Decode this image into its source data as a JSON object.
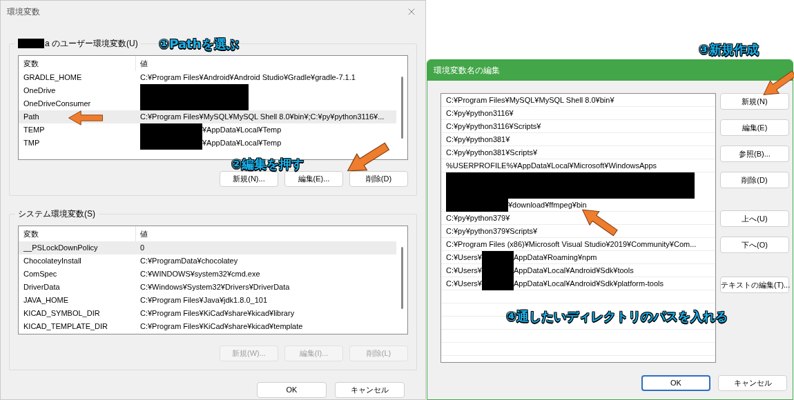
{
  "env_dialog": {
    "title": "環境変数",
    "user_group": {
      "label": [
        {
          "kind": "redacted"
        },
        {
          "kind": "text",
          "text": "a のユーザー環境変数(U)"
        }
      ],
      "columns": [
        "変数",
        "値"
      ],
      "rows": [
        {
          "name": "GRADLE_HOME",
          "value": [
            {
              "kind": "text",
              "text": "C:¥Program Files¥Android¥Android Studio¥Gradle¥gradle-7.1.1"
            }
          ],
          "selected": false
        },
        {
          "name": "OneDrive",
          "value": [
            {
              "kind": "redacted"
            }
          ],
          "selected": false
        },
        {
          "name": "OneDriveConsumer",
          "value": [
            {
              "kind": "redacted"
            }
          ],
          "selected": false
        },
        {
          "name": "Path",
          "value": [
            {
              "kind": "text",
              "text": "C:¥Program Files¥MySQL¥MySQL Shell 8.0¥bin¥;C:¥py¥python3116¥..."
            }
          ],
          "selected": true
        },
        {
          "name": "TEMP",
          "value": [
            {
              "kind": "redacted"
            },
            {
              "kind": "text",
              "text": "¥AppData¥Local¥Temp"
            }
          ],
          "selected": false
        },
        {
          "name": "TMP",
          "value": [
            {
              "kind": "redacted"
            },
            {
              "kind": "text",
              "text": "¥AppData¥Local¥Temp"
            }
          ],
          "selected": false
        }
      ],
      "buttons": [
        {
          "label": "新規(N)...",
          "disabled": false
        },
        {
          "label": "編集(E)...",
          "disabled": false
        },
        {
          "label": "削除(D)",
          "disabled": false
        }
      ]
    },
    "system_group": {
      "label": [
        {
          "kind": "text",
          "text": "システム環境変数(S)"
        }
      ],
      "columns": [
        "変数",
        "値"
      ],
      "rows": [
        {
          "name": "__PSLockDownPolicy",
          "value": [
            {
              "kind": "text",
              "text": "0"
            }
          ],
          "selected": true
        },
        {
          "name": "ChocolateyInstall",
          "value": [
            {
              "kind": "text",
              "text": "C:¥ProgramData¥chocolatey"
            }
          ],
          "selected": false
        },
        {
          "name": "ComSpec",
          "value": [
            {
              "kind": "text",
              "text": "C:¥WINDOWS¥system32¥cmd.exe"
            }
          ],
          "selected": false
        },
        {
          "name": "DriverData",
          "value": [
            {
              "kind": "text",
              "text": "C:¥Windows¥System32¥Drivers¥DriverData"
            }
          ],
          "selected": false
        },
        {
          "name": "JAVA_HOME",
          "value": [
            {
              "kind": "text",
              "text": "C:¥Program Files¥Java¥jdk1.8.0_101"
            }
          ],
          "selected": false
        },
        {
          "name": "KICAD_SYMBOL_DIR",
          "value": [
            {
              "kind": "text",
              "text": "C:¥Program Files¥KiCad¥share¥kicad¥library"
            }
          ],
          "selected": false
        },
        {
          "name": "KICAD_TEMPLATE_DIR",
          "value": [
            {
              "kind": "text",
              "text": "C:¥Program Files¥KiCad¥share¥kicad¥template"
            }
          ],
          "selected": false
        }
      ],
      "buttons": [
        {
          "label": "新規(W)...",
          "disabled": true
        },
        {
          "label": "編集(I)...",
          "disabled": true
        },
        {
          "label": "削除(L)",
          "disabled": true
        }
      ]
    },
    "buttons": [
      {
        "label": "OK",
        "default": false
      },
      {
        "label": "キャンセル",
        "default": false
      }
    ]
  },
  "edit_dialog": {
    "title": "環境変数名の編集",
    "active": true,
    "items": [
      {
        "kind": "text",
        "parts": [
          {
            "kind": "text",
            "text": "C:¥Program Files¥MySQL¥MySQL Shell 8.0¥bin¥"
          }
        ]
      },
      {
        "kind": "text",
        "parts": [
          {
            "kind": "text",
            "text": "C:¥py¥python3116¥"
          }
        ]
      },
      {
        "kind": "text",
        "parts": [
          {
            "kind": "text",
            "text": "C:¥py¥python3116¥Scripts¥"
          }
        ]
      },
      {
        "kind": "text",
        "parts": [
          {
            "kind": "text",
            "text": "C:¥py¥python381¥"
          }
        ]
      },
      {
        "kind": "text",
        "parts": [
          {
            "kind": "text",
            "text": "C:¥py¥python381¥Scripts¥"
          }
        ]
      },
      {
        "kind": "text",
        "parts": [
          {
            "kind": "text",
            "text": "%USERPROFILE%¥AppData¥Local¥Microsoft¥WindowsApps"
          }
        ]
      },
      {
        "kind": "hidden"
      },
      {
        "kind": "hidden"
      },
      {
        "kind": "text",
        "parts": [
          {
            "kind": "redacted"
          },
          {
            "kind": "text",
            "text": "¥download¥ffmpeg¥bin"
          }
        ]
      },
      {
        "kind": "text",
        "parts": [
          {
            "kind": "text",
            "text": "C:¥py¥python379¥"
          }
        ]
      },
      {
        "kind": "text",
        "parts": [
          {
            "kind": "text",
            "text": "C:¥py¥python379¥Scripts¥"
          }
        ]
      },
      {
        "kind": "text",
        "parts": [
          {
            "kind": "text",
            "text": "C:¥Program Files (x86)¥Microsoft Visual Studio¥2019¥Community¥Com..."
          }
        ]
      },
      {
        "kind": "text",
        "parts": [
          {
            "kind": "text",
            "text": "C:¥Users¥"
          },
          {
            "kind": "redacted"
          },
          {
            "kind": "text",
            "text": "AppData¥Roaming¥npm"
          }
        ]
      },
      {
        "kind": "text",
        "parts": [
          {
            "kind": "text",
            "text": "C:¥Users¥"
          },
          {
            "kind": "redacted"
          },
          {
            "kind": "text",
            "text": "AppData¥Local¥Android¥Sdk¥tools"
          }
        ]
      },
      {
        "kind": "text",
        "parts": [
          {
            "kind": "text",
            "text": "C:¥Users¥"
          },
          {
            "kind": "redacted"
          },
          {
            "kind": "text",
            "text": "AppData¥Local¥Android¥Sdk¥platform-tools"
          }
        ]
      }
    ],
    "side_buttons": [
      [
        {
          "label": "新規(N)"
        },
        {
          "label": "編集(E)"
        },
        {
          "label": "参照(B)..."
        },
        {
          "label": "削除(D)"
        }
      ],
      [
        {
          "label": "上へ(U)"
        },
        {
          "label": "下へ(O)"
        }
      ],
      [
        {
          "label": "テキストの編集(T)..."
        }
      ]
    ],
    "buttons": [
      {
        "label": "OK",
        "default": true
      },
      {
        "label": "キャンセル",
        "default": false
      }
    ]
  },
  "annotations": [
    "①Pathを選ぶ",
    "②編集を押す",
    "③新規作成",
    "④通したいディレクトリのパスを入れる"
  ]
}
